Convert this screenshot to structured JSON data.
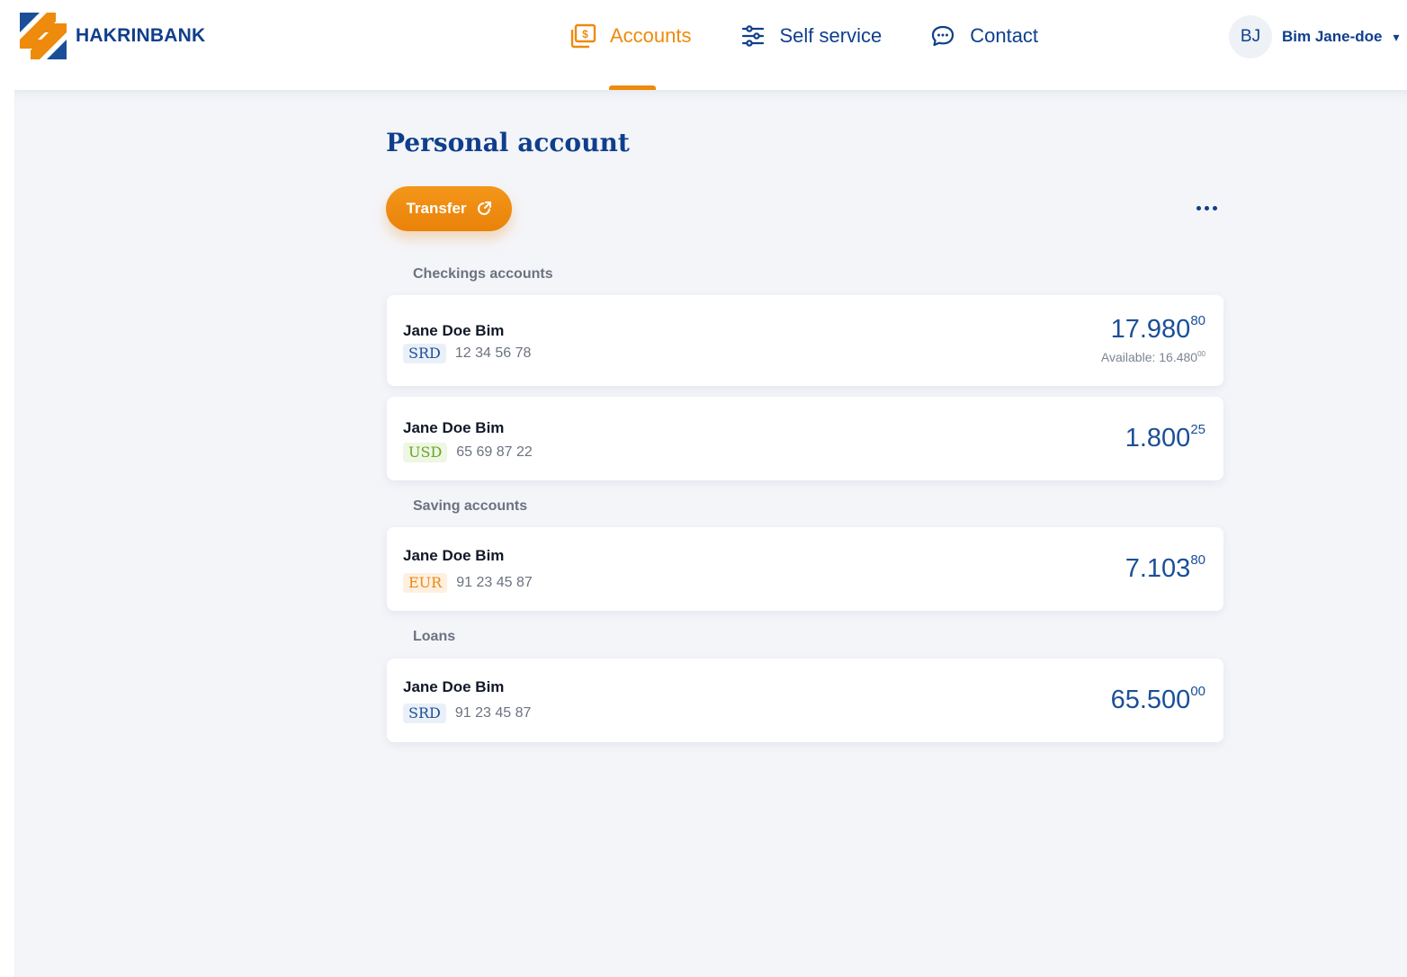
{
  "brand": {
    "name": "HAKRINBANK",
    "colors": {
      "orange": "#ee8a0c",
      "blue": "#0f3f8c"
    }
  },
  "nav": {
    "items": [
      {
        "label": "Accounts",
        "icon": "banknote-icon",
        "active": true
      },
      {
        "label": "Self service",
        "icon": "sliders-icon",
        "active": false
      },
      {
        "label": "Contact",
        "icon": "chat-bubble-icon",
        "active": false
      }
    ]
  },
  "user": {
    "initials": "BJ",
    "name": "Bim Jane-doe"
  },
  "page": {
    "title": "Personal account"
  },
  "actions": {
    "transfer_label": "Transfer",
    "transfer_icon": "external-link-icon",
    "more_icon": "more-dots-icon"
  },
  "sections": [
    {
      "label": "Checkings accounts",
      "accounts": [
        {
          "holder": "Jane Doe Bim",
          "currency": "SRD",
          "number": "12 34 56 78",
          "amount_main": "17.980",
          "amount_cents": "80",
          "available_label": "Available: 16.480",
          "available_cents": "00"
        },
        {
          "holder": "Jane Doe Bim",
          "currency": "USD",
          "number": "65 69 87 22",
          "amount_main": "1.800",
          "amount_cents": "25"
        }
      ]
    },
    {
      "label": "Saving accounts",
      "accounts": [
        {
          "holder": "Jane Doe Bim",
          "currency": "EUR",
          "number": "91 23 45 87",
          "amount_main": "7.103",
          "amount_cents": "80"
        }
      ]
    },
    {
      "label": "Loans",
      "accounts": [
        {
          "holder": "Jane Doe Bim",
          "currency": "SRD",
          "number": "91 23 45 87",
          "amount_main": "65.500",
          "amount_cents": "00"
        }
      ]
    }
  ]
}
